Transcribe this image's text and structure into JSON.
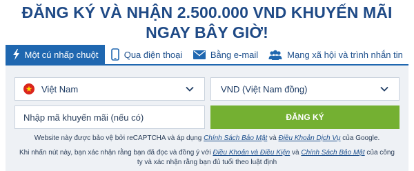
{
  "header": {
    "title": "ĐĂNG KÝ VÀ NHẬN 2.500.000 VND KHUYẾN MÃI NGAY BÂY GIỜ!"
  },
  "tabs": [
    {
      "label": "Một cú nhấp chuột",
      "icon": "lightning-icon",
      "active": true
    },
    {
      "label": "Qua điện thoại",
      "icon": "phone-icon",
      "active": false
    },
    {
      "label": "Bằng e-mail",
      "icon": "envelope-icon",
      "active": false
    },
    {
      "label": "Mạng xã hội và trình nhắn tin",
      "icon": "users-icon",
      "active": false
    }
  ],
  "form": {
    "country": {
      "value": "Việt Nam",
      "icon": "vietnam-flag-icon"
    },
    "currency": {
      "value": "VND (Việt Nam đồng)"
    },
    "promo_code": {
      "placeholder": "Nhập mã khuyến mãi (nếu có)",
      "value": ""
    },
    "register_label": "ĐĂNG KÝ"
  },
  "legal": {
    "recaptcha_prefix": "Website này được bảo vệ bởi reCAPTCHA và áp dụng ",
    "privacy_policy_link": "Chính Sách Bảo Mật",
    "recaptcha_and": " và ",
    "terms_of_service_link": "Điều Khoản Dịch Vụ",
    "recaptcha_suffix": " của Google.",
    "consent_prefix": "Khi nhấn nút này, bạn xác nhận rằng bạn đã đọc và đồng ý với ",
    "terms_link": "Điều Khoản và Điều Kiện",
    "consent_and": " và ",
    "company_privacy_link": "Chính Sách Bảo Mật",
    "consent_suffix": " của công ty và xác nhận rằng bạn đủ tuổi theo luật định"
  },
  "colors": {
    "title": "#1f4a86",
    "tab_active_bg": "#1f67b0",
    "register_bg": "#74b032",
    "panel_bg": "#eef1f5"
  }
}
